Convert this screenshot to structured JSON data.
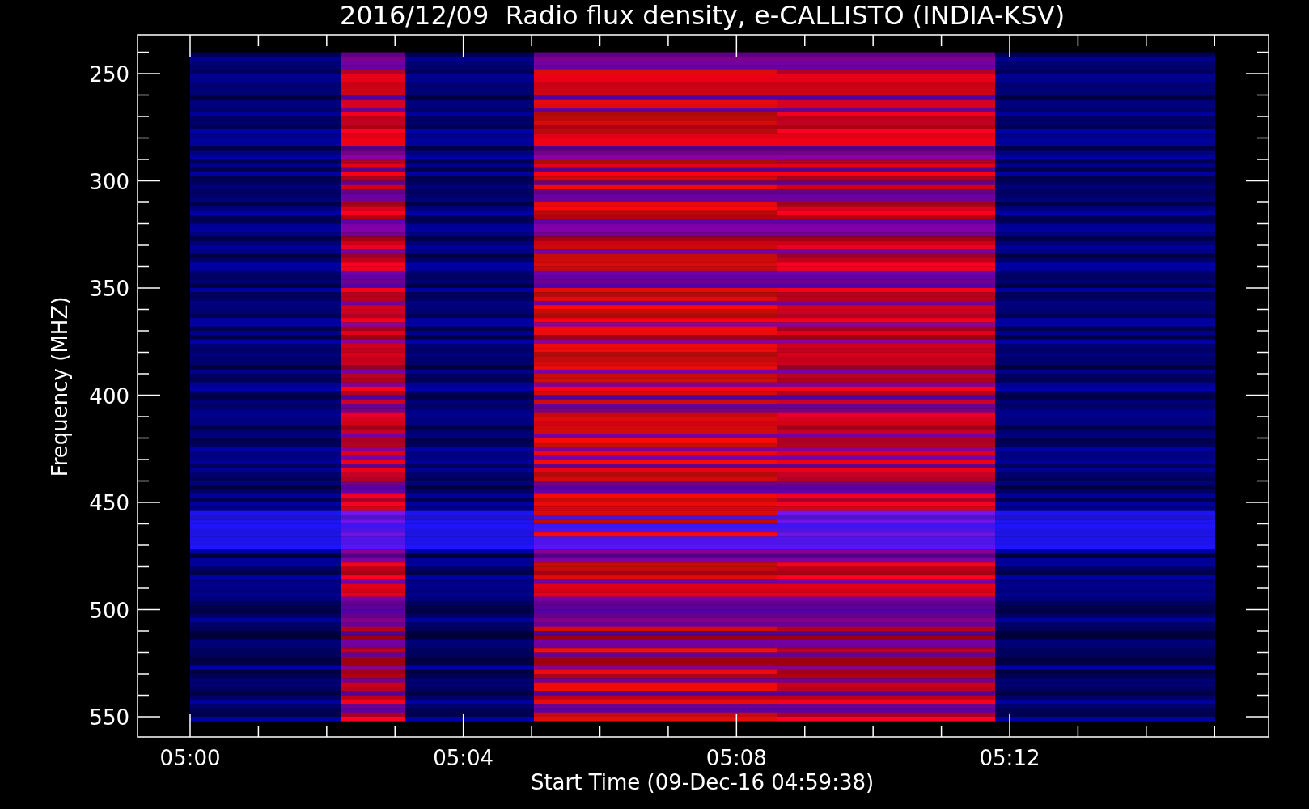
{
  "title": "2016/12/09  Radio flux density, e-CALLISTO (INDIA-KSV)",
  "y_axis": {
    "title": "Frequency (MHZ)",
    "tick_labels": [
      "250",
      "300",
      "350",
      "400",
      "450",
      "500",
      "550"
    ]
  },
  "x_axis": {
    "title": "Start Time (09-Dec-16 04:59:38)",
    "tick_labels": [
      "05:00",
      "05:04",
      "05:08",
      "05:12"
    ]
  }
}
